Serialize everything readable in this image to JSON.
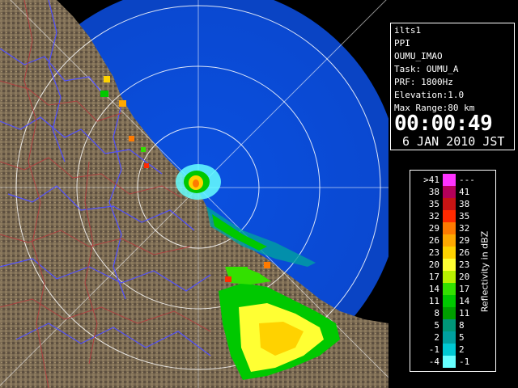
{
  "info": {
    "site": "ilts1",
    "scan_mode": "PPI",
    "product": "OUMU_IMAO",
    "task": "Task: OUMU_A",
    "prf": "PRF: 1800Hz",
    "elevation": "Elevation:1.0",
    "max_range": "Max Range:80 km",
    "time": "00:00:49",
    "date": "6 JAN 2010 JST"
  },
  "legend": {
    "title": "Reflectivity in dBZ",
    "rows": [
      {
        "low": ">41",
        "high": "---",
        "color": "#ff33ff"
      },
      {
        "low": "38",
        "high": "41",
        "color": "#b3005a"
      },
      {
        "low": "35",
        "high": "38",
        "color": "#c81414"
      },
      {
        "low": "32",
        "high": "35",
        "color": "#ff2a00"
      },
      {
        "low": "29",
        "high": "32",
        "color": "#ff7a00"
      },
      {
        "low": "26",
        "high": "29",
        "color": "#ffa800"
      },
      {
        "low": "23",
        "high": "26",
        "color": "#ffd200"
      },
      {
        "low": "20",
        "high": "23",
        "color": "#ffff33"
      },
      {
        "low": "17",
        "high": "20",
        "color": "#b8f000"
      },
      {
        "low": "14",
        "high": "17",
        "color": "#33e000"
      },
      {
        "low": "11",
        "high": "14",
        "color": "#00c800"
      },
      {
        "low": "8",
        "high": "11",
        "color": "#00a000"
      },
      {
        "low": "5",
        "high": "8",
        "color": "#009678"
      },
      {
        "low": "2",
        "high": "5",
        "color": "#00a0a0"
      },
      {
        "low": "-1",
        "high": "2",
        "color": "#00c8d2"
      },
      {
        "low": "-4",
        "high": "-1",
        "color": "#66ffff"
      }
    ]
  },
  "colors": {
    "radar_background": "#0050d8",
    "radar_outer": "#0a46c8",
    "land": "#7a6a52",
    "rivers": "#4a4aff",
    "boundaries": "#b04040",
    "range_rings": "#ffffff"
  }
}
